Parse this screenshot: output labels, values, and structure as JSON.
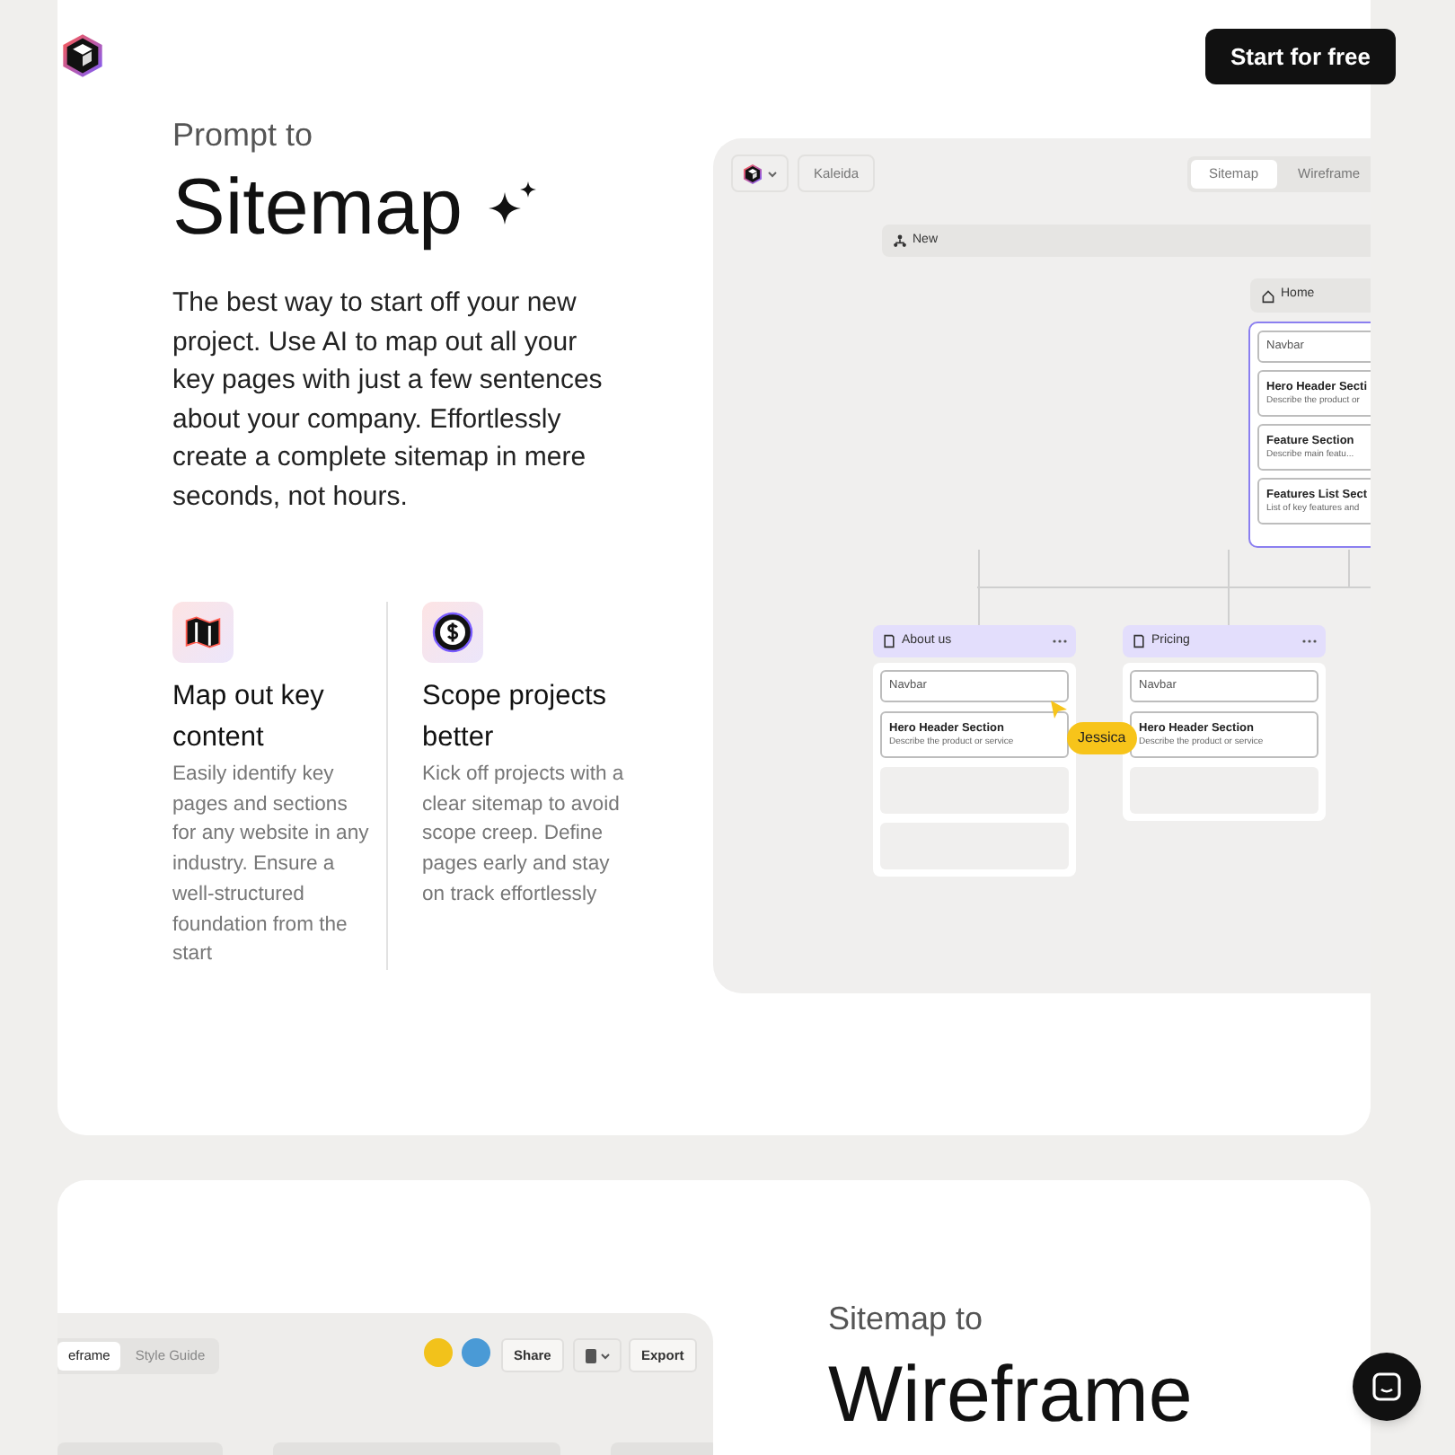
{
  "header": {
    "cta": "Start for free"
  },
  "section1": {
    "eyebrow": "Prompt to",
    "title": "Sitemap",
    "description": "The best way to start off your new project. Use AI to map out all your key pages with just a few sentences about your company. Effortlessly create a complete sitemap in mere seconds, not hours.",
    "features": [
      {
        "kind": "map",
        "title": "Map out key content",
        "description": "Easily identify key pages and sections for any website in any industry. Ensure a well-structured foundation from the start"
      },
      {
        "kind": "dollar",
        "title": "Scope projects better",
        "description": "Kick off projects with a clear sitemap to avoid scope creep. Define pages early and stay on track effortlessly"
      }
    ],
    "mockup": {
      "project": "Kaleida",
      "tabs": [
        {
          "label": "Sitemap",
          "selected": true
        },
        {
          "label": "Wireframe",
          "selected": false
        }
      ],
      "new_bar": "New",
      "home": {
        "title": "Home",
        "sections": [
          {
            "kind": "navbar",
            "title": "Navbar"
          },
          {
            "kind": "section",
            "title": "Hero Header Secti",
            "description": "Describe the product or"
          },
          {
            "kind": "section",
            "title": "Feature Section",
            "description": "Describe main featu..."
          },
          {
            "kind": "section",
            "title": "Features List Sect",
            "description": "List of key features and"
          }
        ]
      },
      "pages": [
        {
          "title": "About us",
          "sections": [
            {
              "kind": "navbar",
              "title": "Navbar"
            },
            {
              "kind": "section",
              "title": "Hero Header Section",
              "description": "Describe the product or service"
            },
            {
              "kind": "empty"
            },
            {
              "kind": "empty"
            }
          ]
        },
        {
          "title": "Pricing",
          "sections": [
            {
              "kind": "navbar",
              "title": "Navbar"
            },
            {
              "kind": "section",
              "title": "Hero Header Section",
              "description": "Describe the product or service"
            },
            {
              "kind": "empty"
            }
          ]
        }
      ],
      "cursor": {
        "label": "Jessica"
      }
    }
  },
  "section2": {
    "eyebrow": "Sitemap to",
    "title": "Wireframe",
    "mockup": {
      "tabs": [
        {
          "label": "eframe",
          "selected": true
        },
        {
          "label": "Style Guide",
          "selected": false
        }
      ],
      "share": "Share",
      "export": "Export"
    }
  }
}
